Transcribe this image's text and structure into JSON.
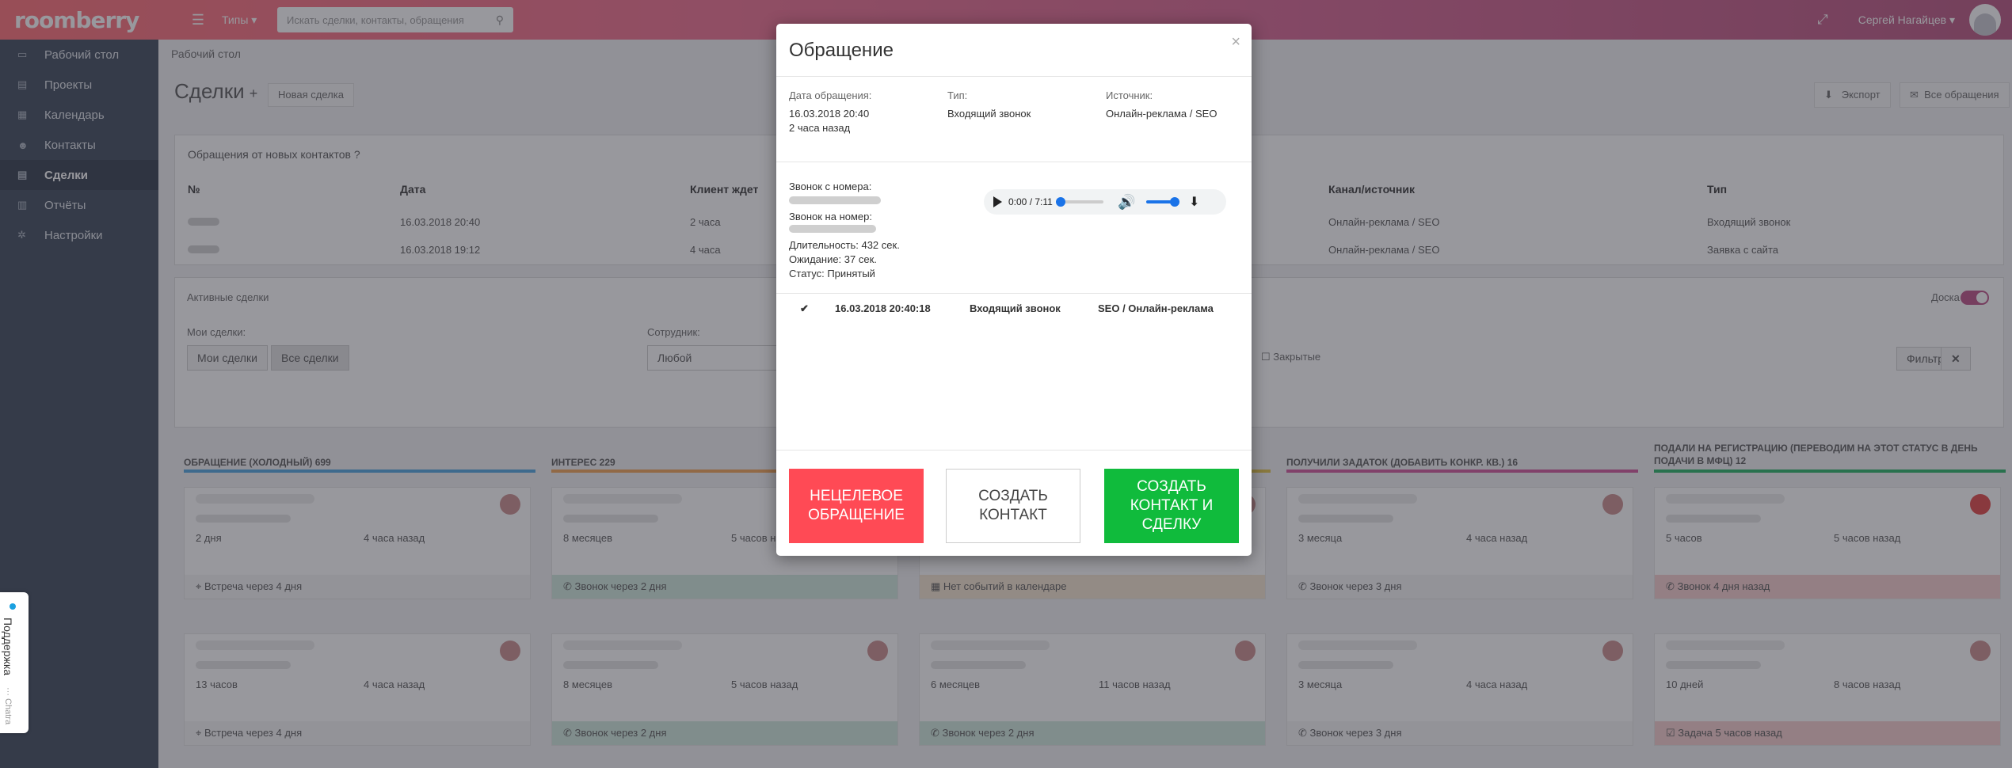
{
  "topbar": {
    "logo": "roomberry",
    "types": "Типы",
    "search_placeholder": "Искать сделки, контакты, обращения",
    "user": "Сергей Нагайцев"
  },
  "sidebar": {
    "items": [
      {
        "label": "Рабочий стол",
        "icon": "monitor-icon"
      },
      {
        "label": "Проекты",
        "icon": "file-icon"
      },
      {
        "label": "Календарь",
        "icon": "calendar-icon"
      },
      {
        "label": "Контакты",
        "icon": "users-icon"
      },
      {
        "label": "Сделки",
        "icon": "document-icon",
        "active": true
      },
      {
        "label": "Отчёты",
        "icon": "chart-icon"
      },
      {
        "label": "Настройки",
        "icon": "gear-icon"
      }
    ]
  },
  "page": {
    "breadcrumb": "Рабочий стол",
    "title": "Сделки",
    "new_deal": "Новая сделка",
    "export": "Экспорт",
    "all_requests": "Все обращения"
  },
  "new_contacts": {
    "heading": "Обращения от новых контактов",
    "columns": [
      "№",
      "Дата",
      "Клиент ждет",
      "Канал/источник",
      "Тип"
    ],
    "rows": [
      {
        "date": "16.03.2018 20:40",
        "wait": "2 часа",
        "channel": "Онлайн-реклама / SEO",
        "type": "Входящий звонок"
      },
      {
        "date": "16.03.2018 19:12",
        "wait": "4 часа",
        "channel": "Онлайн-реклама / SEO",
        "type": "Заявка с сайта"
      }
    ]
  },
  "active_deals": {
    "heading": "Активные сделки",
    "board_label": "Доска",
    "my_deals_label": "Мои сделки:",
    "my_deals": "Мои сделки",
    "all_deals": "Все сделки",
    "employee_label": "Сотрудник:",
    "employee_value": "Любой",
    "closed": "Закрытые",
    "filter": "Фильтр"
  },
  "columns": [
    {
      "title": "ОБРАЩЕНИЕ (ХОЛОДНЫЙ)",
      "count": "699",
      "color": "#4aa3df"
    },
    {
      "title": "ИНТЕРЕС",
      "count": "229",
      "color": "#f0a050"
    },
    {
      "title": "",
      "count": "",
      "color": "#e0c040"
    },
    {
      "title": "ПОЛУЧИЛИ ЗАДАТОК (ДОБАВИТЬ КОНКР. КВ.)",
      "count": "16",
      "color": "#d05098"
    },
    {
      "title": "ПОДАЛИ НА РЕГИСТРАЦИЮ (ПЕРЕВОДИМ НА ЭТОТ СТАТУС В ДЕНЬ ПОДАЧИ В МФЦ)",
      "count": "12",
      "color": "#20b060"
    }
  ],
  "cards": [
    {
      "left": "2 дня",
      "right": "4 часа назад",
      "footer": "Встреча через 4 дня"
    },
    {
      "left": "8 месяцев",
      "right": "5 часов назад",
      "footer": "Звонок через 2 дня"
    },
    {
      "left": "",
      "right": "",
      "footer": "Нет событий в календаре"
    },
    {
      "left": "3 месяца",
      "right": "4 часа назад",
      "footer": "Звонок через 3 дня"
    },
    {
      "left": "5 часов",
      "right": "5 часов назад",
      "footer": "Звонок 4 дня назад"
    },
    {
      "left": "13 часов",
      "right": "4 часа назад",
      "footer": "Встреча через 4 дня"
    },
    {
      "left": "8 месяцев",
      "right": "5 часов назад",
      "footer": "Звонок через 2 дня"
    },
    {
      "left": "6 месяцев",
      "right": "11 часов назад",
      "footer": "Звонок через 2 дня"
    },
    {
      "left": "3 месяца",
      "right": "4 часа назад",
      "footer": "Звонок через 3 дня"
    },
    {
      "left": "10 дней",
      "right": "8 часов назад",
      "footer": "Задача 5 часов назад"
    }
  ],
  "support": {
    "label": "Поддержка",
    "sub": "··· Chatra"
  },
  "modal": {
    "title": "Обращение",
    "date_label": "Дата обращения:",
    "date_value": "16.03.2018 20:40",
    "date_ago": "2 часа назад",
    "type_label": "Тип:",
    "type_value": "Входящий звонок",
    "source_label": "Источник:",
    "source_value": "Онлайн-реклама / SEO",
    "call_from": "Звонок с номера:",
    "call_to": "Звонок на номер:",
    "duration": "Длительность: 432 сек.",
    "waiting": "Ожидание: 37 сек.",
    "status": "Статус: Принятый",
    "player_time": "0:00 / 7:11",
    "row": {
      "check": "✔",
      "datetime": "16.03.2018 20:40:18",
      "type": "Входящий звонок",
      "source": "SEO / Онлайн-реклама"
    },
    "btn_untargeted": "Нецелевое обращение",
    "btn_contact": "Создать контакт",
    "btn_contact_deal": "Создать контакт и сделку"
  }
}
